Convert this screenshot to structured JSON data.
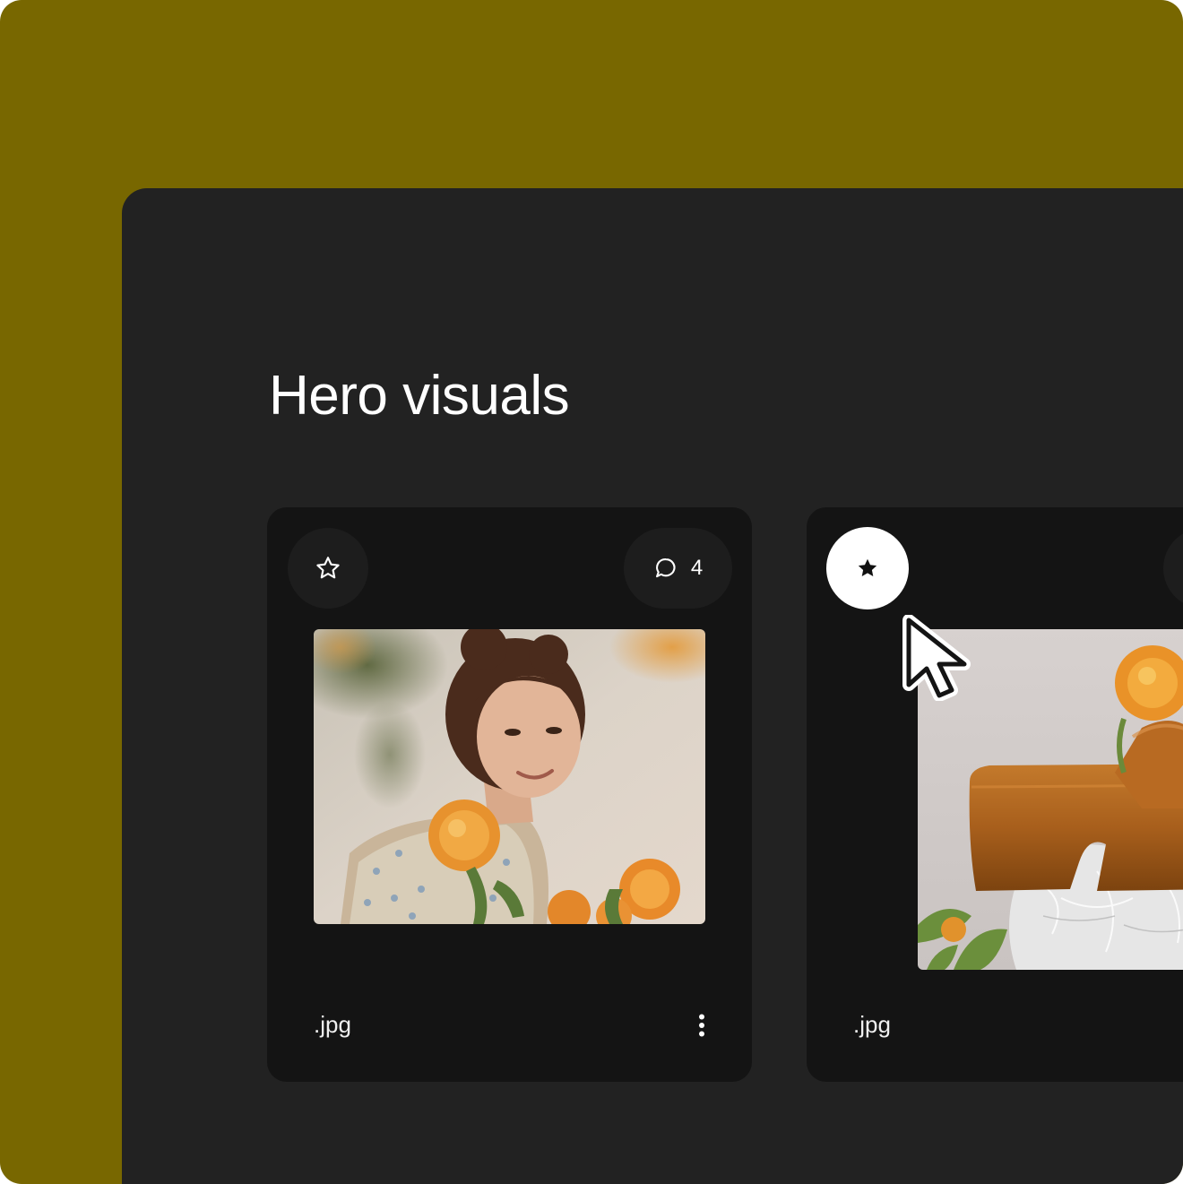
{
  "colors": {
    "backdrop": "#786700",
    "panel": "#222222",
    "card": "#141414",
    "pill": "#1d1d1d",
    "active_button": "#ffffff",
    "icon_on_dark": "#ffffff",
    "icon_on_light": "#111111"
  },
  "page": {
    "section_title": "Hero visuals"
  },
  "cards": [
    {
      "favorite_icon": "star-outline-icon",
      "favorited": false,
      "comment_icon": "speech-bubble-icon",
      "comment_count": "4",
      "image": "portrait of woman holding orange protea flowers",
      "file_ext": ".jpg",
      "menu_icon": "vertical-ellipsis-icon"
    },
    {
      "favorite_icon": "star-filled-icon",
      "favorited": true,
      "image": "tan leather platform shoe with orange protea flowers on plastic wrap",
      "file_ext": ".jpg"
    }
  ],
  "pointer": {
    "icon": "mouse-pointer-icon"
  }
}
